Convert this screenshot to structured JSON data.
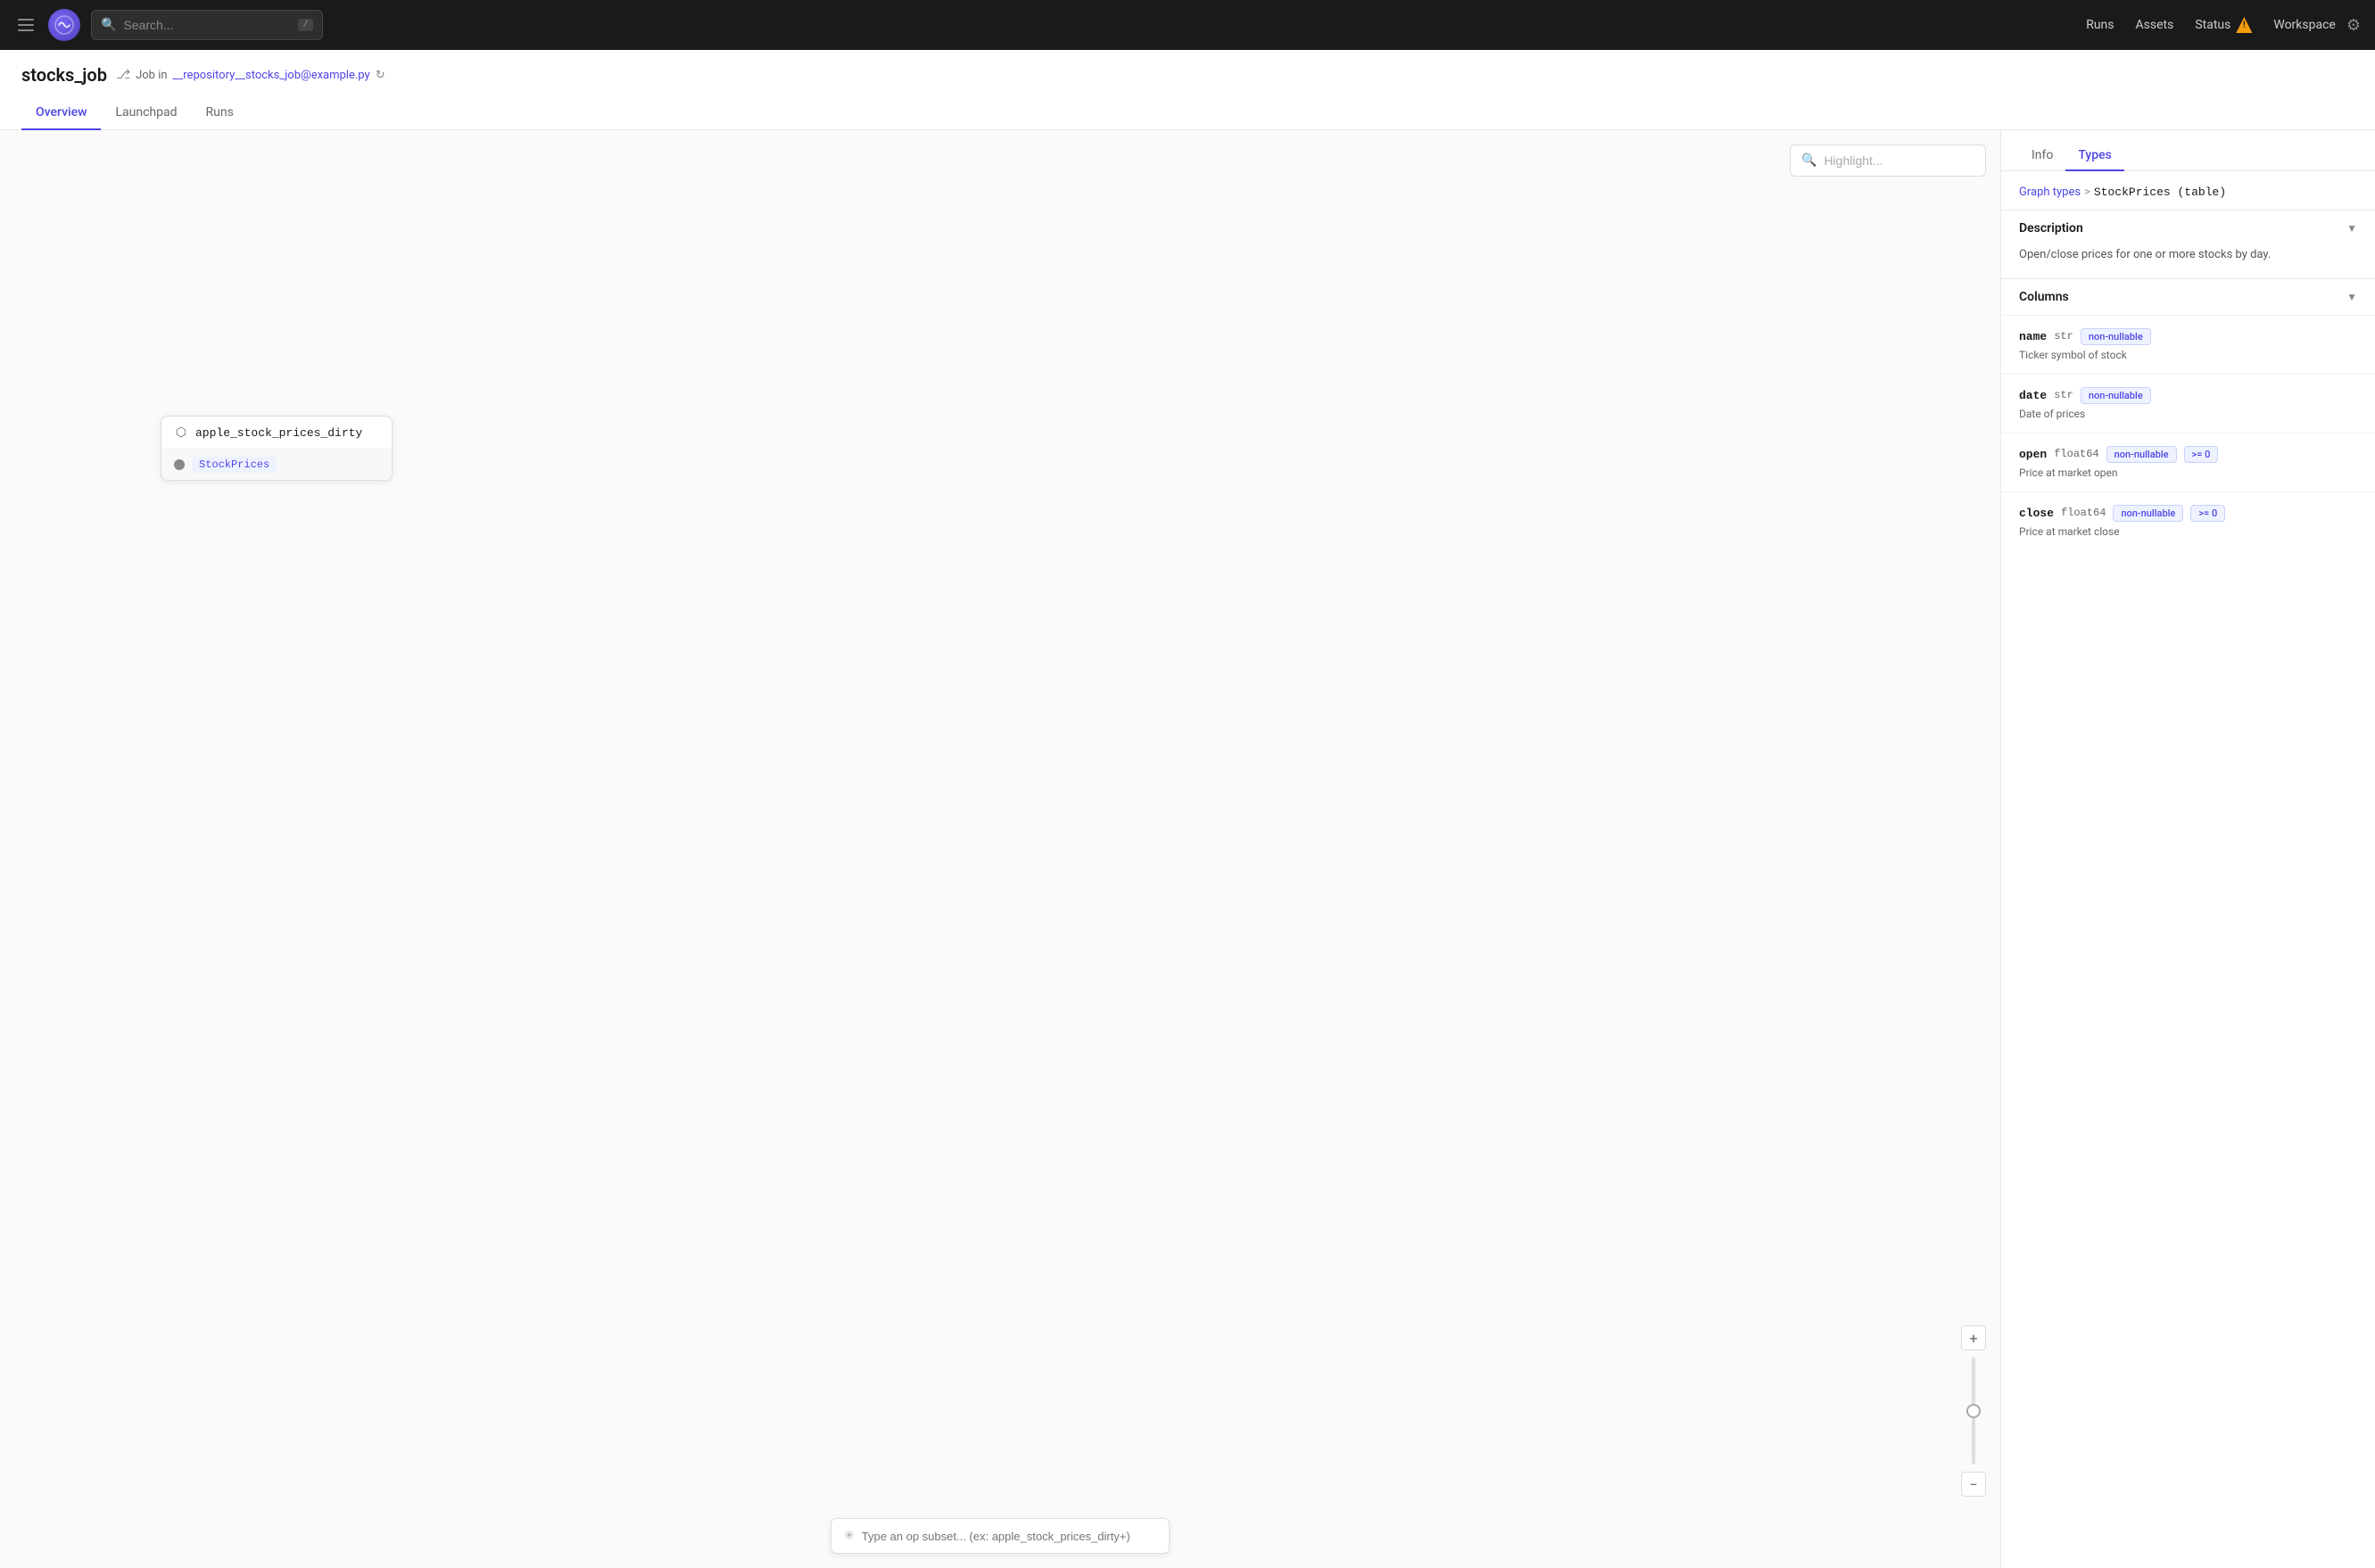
{
  "topnav": {
    "search_placeholder": "Search...",
    "search_shortcut": "/",
    "links": {
      "runs": "Runs",
      "assets": "Assets",
      "status": "Status",
      "workspace": "Workspace"
    }
  },
  "page": {
    "title": "stocks_job",
    "subtitle_icon": "⎇",
    "subtitle_text": "Job in",
    "subtitle_link": "__repository__stocks_job@example.py",
    "tabs": [
      "Overview",
      "Launchpad",
      "Runs"
    ],
    "active_tab": "Overview"
  },
  "graph": {
    "highlight_placeholder": "Highlight...",
    "node": {
      "op_name": "apple_stock_prices_dirty",
      "output_label": "StockPrices"
    },
    "op_subset_placeholder": "Type an op subset... (ex: apple_stock_prices_dirty+)"
  },
  "right_panel": {
    "tabs": [
      "Info",
      "Types"
    ],
    "active_tab": "Types",
    "breadcrumb": {
      "parent": "Graph types",
      "separator": ">",
      "current": "StockPrices (table)"
    },
    "description_section": {
      "title": "Description",
      "text": "Open/close prices for one or more stocks by day."
    },
    "columns_section": {
      "title": "Columns",
      "columns": [
        {
          "name": "name",
          "type": "str",
          "tags": [
            "non-nullable"
          ],
          "description": "Ticker symbol of stock"
        },
        {
          "name": "date",
          "type": "str",
          "tags": [
            "non-nullable"
          ],
          "description": "Date of prices"
        },
        {
          "name": "open",
          "type": "float64",
          "tags": [
            "non-nullable",
            ">= 0"
          ],
          "description": "Price at market open"
        },
        {
          "name": "close",
          "type": "float64",
          "tags": [
            "non-nullable",
            ">= 0"
          ],
          "description": "Price at market close"
        }
      ]
    }
  }
}
